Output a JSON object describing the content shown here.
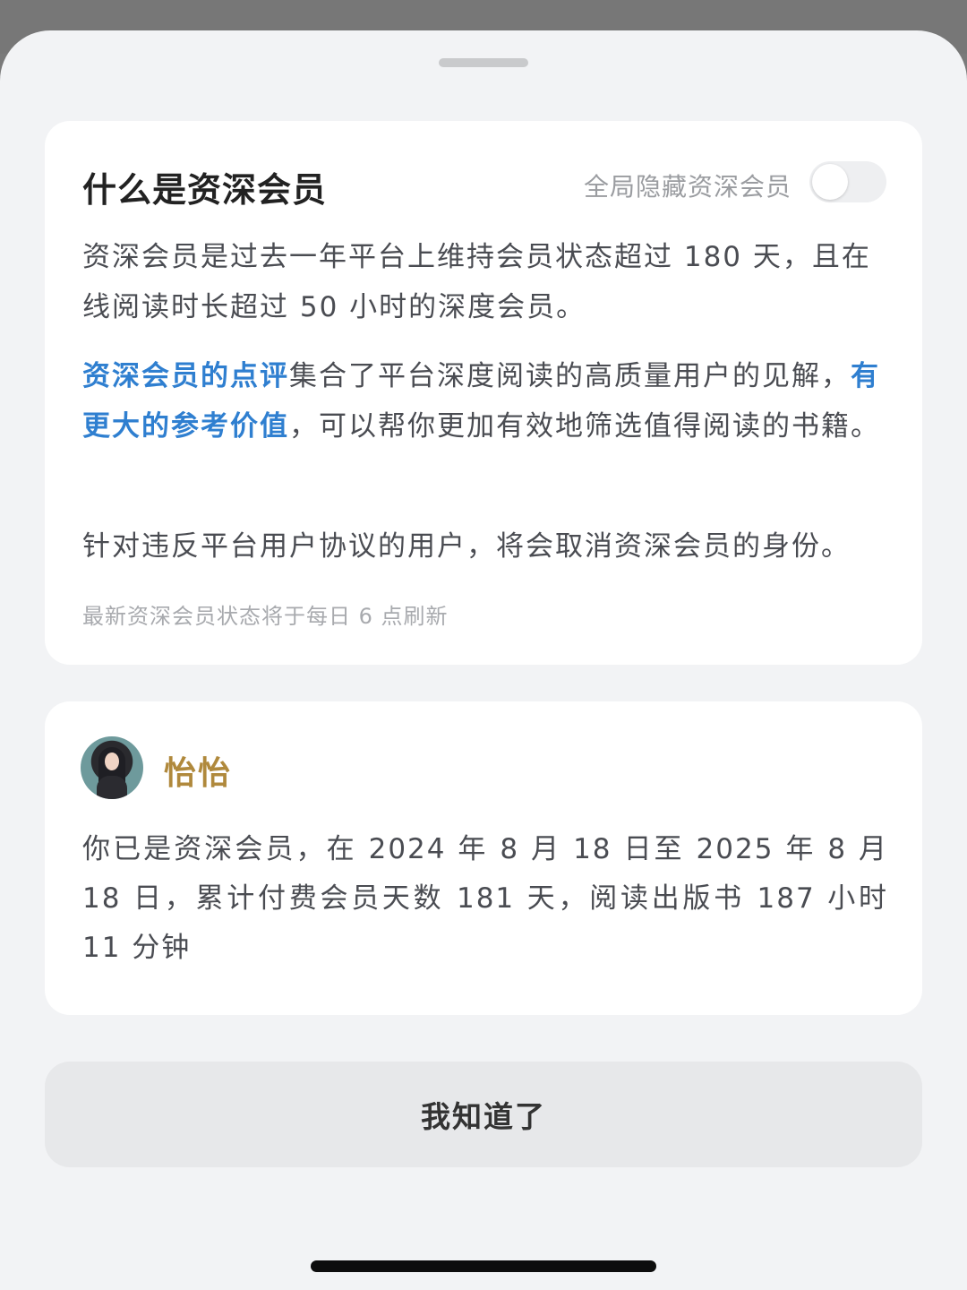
{
  "info_card": {
    "title": "什么是资深会员",
    "toggle_label": "全局隐藏资深会员",
    "toggle_on": false,
    "paragraph1": "资深会员是过去一年平台上维持会员状态超过 180 天，且在线阅读时长超过 50 小时的深度会员。",
    "paragraph2": {
      "highlight1": "资深会员的点评",
      "text1": "集合了平台深度阅读的高质量用户的见解，",
      "highlight2": "有更大的参考价值",
      "text2": "，可以帮你更加有效地筛选值得阅读的书籍。"
    },
    "paragraph3": "针对违反平台用户协议的用户，将会取消资深会员的身份。",
    "footnote": "最新资深会员状态将于每日 6 点刷新"
  },
  "user_card": {
    "username": "怡怡",
    "status_text": "你已是资深会员，在 2024 年 8 月 18 日至 2025 年 8 月 18 日，累计付费会员天数 181 天，阅读出版书 187 小时 11 分钟"
  },
  "actions": {
    "confirm_label": "我知道了"
  },
  "colors": {
    "highlight": "#2f7fd0",
    "username": "#b0893c",
    "sheet_background": "#f2f3f5"
  }
}
